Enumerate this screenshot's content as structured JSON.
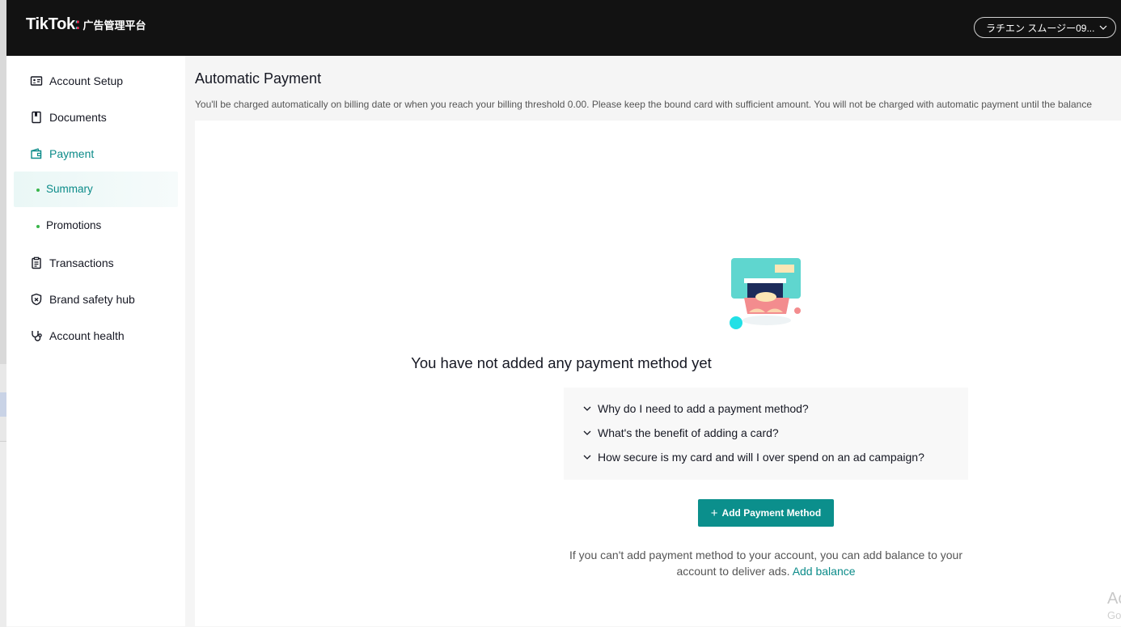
{
  "header": {
    "brand": "TikTok",
    "brand_colon": ":",
    "brand_sub": "广告管理平台",
    "account_label": "ラチエン スムージー09..."
  },
  "sidebar": {
    "items": [
      {
        "label": "Account Setup",
        "icon": "id-card-icon"
      },
      {
        "label": "Documents",
        "icon": "bookmark-icon"
      },
      {
        "label": "Payment",
        "icon": "wallet-icon"
      },
      {
        "label": "Transactions",
        "icon": "clipboard-icon"
      },
      {
        "label": "Brand safety hub",
        "icon": "shield-icon"
      },
      {
        "label": "Account health",
        "icon": "stethoscope-icon"
      }
    ],
    "payment_sub": [
      {
        "label": "Summary"
      },
      {
        "label": "Promotions"
      }
    ]
  },
  "main": {
    "title": "Automatic Payment",
    "description": "You'll be charged automatically on billing date or when you reach your billing threshold 0.00. Please keep the bound card with sufficient amount. You will not be charged with automatic payment until the balance",
    "empty_title": "You have not added any payment method yet",
    "faq": [
      "Why do I need to add a payment method?",
      "What's the benefit of adding a card?",
      "How secure is my card and will I over spend on an ad campaign?"
    ],
    "add_button": "Add Payment Method",
    "hint_text": "If you can't add payment method to your account, you can add balance to your account to deliver ads.",
    "hint_link": "Add balance"
  },
  "watermark": {
    "line1": "Ac",
    "line2": "Go"
  },
  "colors": {
    "accent": "#0b8b89",
    "button": "#0b8f8c",
    "header_bg": "#121212"
  }
}
